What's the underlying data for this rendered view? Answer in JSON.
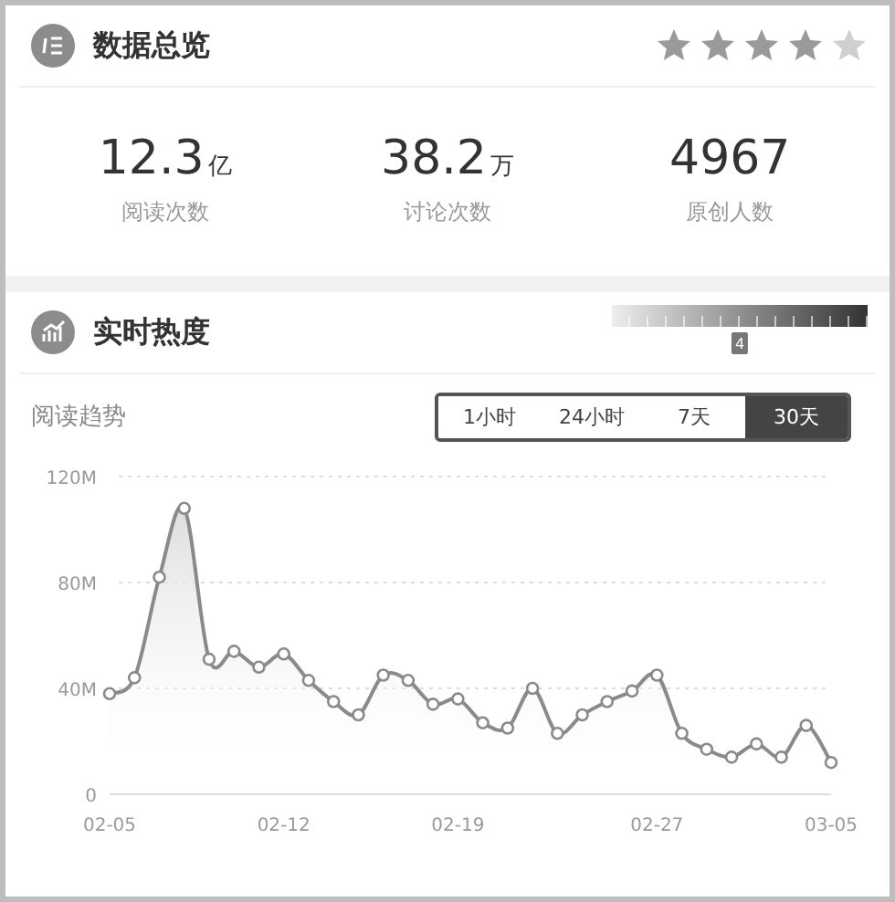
{
  "overview": {
    "title": "数据总览",
    "stars": 4
  },
  "stats": [
    {
      "value": "12.3",
      "unit": "亿",
      "label": "阅读次数"
    },
    {
      "value": "38.2",
      "unit": "万",
      "label": "讨论次数"
    },
    {
      "value": "4967",
      "label": "原创人数"
    }
  ],
  "realtime": {
    "title": "实时热度",
    "heat": {
      "level": 0.5,
      "label": "4"
    }
  },
  "trend": {
    "label": "阅读趋势",
    "tabs": [
      {
        "label": "1小时",
        "selected": false
      },
      {
        "label": "24小时",
        "selected": false
      },
      {
        "label": "7天",
        "selected": false
      },
      {
        "label": "30天",
        "selected": true
      }
    ],
    "chart_data": {
      "type": "area",
      "categories": [
        "02-05",
        null,
        null,
        null,
        null,
        null,
        null,
        "02-12",
        null,
        null,
        null,
        null,
        null,
        null,
        "02-19",
        null,
        null,
        null,
        null,
        null,
        null,
        null,
        "02-27",
        null,
        null,
        null,
        null,
        null,
        null,
        "03-05"
      ],
      "series": [
        {
          "color": "#8a8a8a",
          "values": [
            38,
            44,
            82,
            108,
            51,
            54,
            48,
            53,
            43,
            35,
            30,
            45,
            43,
            34,
            36,
            27,
            25,
            40,
            23,
            30,
            35,
            39,
            45,
            23,
            17,
            14,
            19,
            14,
            26,
            12
          ]
        }
      ],
      "ylim": [
        0,
        120
      ],
      "yticks": [
        {
          "value": 0,
          "label": "0"
        },
        {
          "value": 40,
          "label": "40M"
        },
        {
          "value": 80,
          "label": "80M"
        },
        {
          "value": 120,
          "label": "120M"
        }
      ]
    }
  }
}
